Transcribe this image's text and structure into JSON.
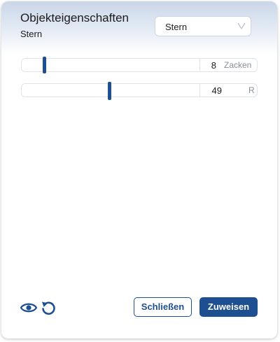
{
  "header": {
    "title": "Objekteigenschaften",
    "subtitle": "Stern"
  },
  "shape_select": {
    "value": "Stern",
    "arrow_icon": "chevron-down-icon"
  },
  "sliders": [
    {
      "value": "8",
      "unit": "Zacken",
      "level": 0.12
    },
    {
      "value": "49",
      "unit": "R",
      "level": 0.49
    }
  ],
  "footer": {
    "preview_icon": "eye-icon",
    "reset_icon": "reset-icon",
    "close_label": "Schließen",
    "assign_label": "Zuweisen"
  },
  "colors": {
    "accent": "#1d4f91",
    "header_gradient_top": "#c9d6e8"
  }
}
